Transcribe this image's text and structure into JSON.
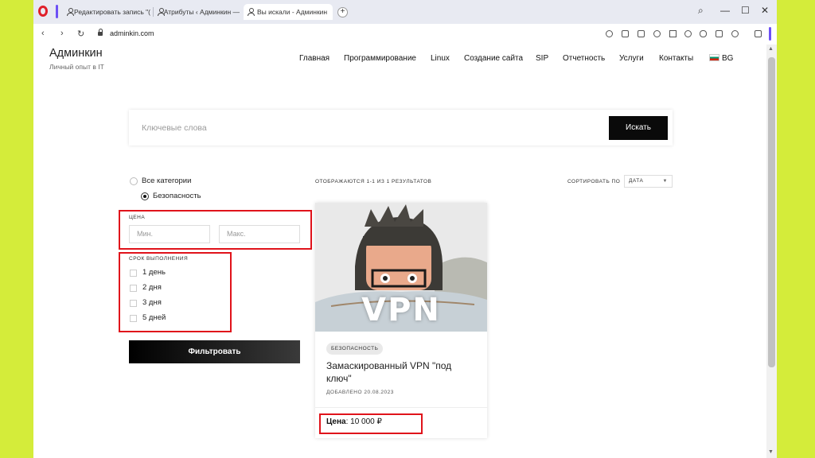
{
  "browser": {
    "tabs": [
      {
        "label": "Редактировать запись \"("
      },
      {
        "label": "Атрибуты ‹ Админкин —"
      },
      {
        "label": "Вы искали - Админкин"
      }
    ],
    "url": "adminkin.com"
  },
  "site": {
    "title": "Админкин",
    "subtitle": "Личный опыт в IT",
    "menu": [
      "Главная",
      "Программирование",
      "Linux",
      "Создание сайта",
      "SIP",
      "Отчетность",
      "Услуги",
      "Контакты",
      "BG"
    ]
  },
  "search": {
    "placeholder": "Ключевые слова",
    "button": "Искать"
  },
  "filters": {
    "category_all": "Все категории",
    "category_selected": "Безопасность",
    "price_title": "ЦЕНА",
    "price_min_placeholder": "Мин.",
    "price_max_placeholder": "Макс.",
    "term_title": "СРОК ВЫПОЛНЕНИЯ",
    "terms": [
      "1 день",
      "2 дня",
      "3 дня",
      "5 дней"
    ],
    "filter_button": "Фильтровать"
  },
  "results": {
    "count_text": "ОТОБРАЖАЮТСЯ 1-1 ИЗ 1 РЕЗУЛЬТАТОВ",
    "sort_label": "СОРТИРОВАТЬ ПО",
    "sort_value": "ДАТА"
  },
  "card": {
    "image_text": "VPN",
    "category": "БЕЗОПАСНОСТЬ",
    "title": "Замаскированный VPN \"под ключ\"",
    "date": "ДОБАВЛЕНО 20.08.2023",
    "price_label": "Цена",
    "price_value": ": 10 000 ₽"
  },
  "colors": {
    "highlight": "#e0131b",
    "background": "#d4ec3a",
    "accent": "#6d50f5"
  }
}
